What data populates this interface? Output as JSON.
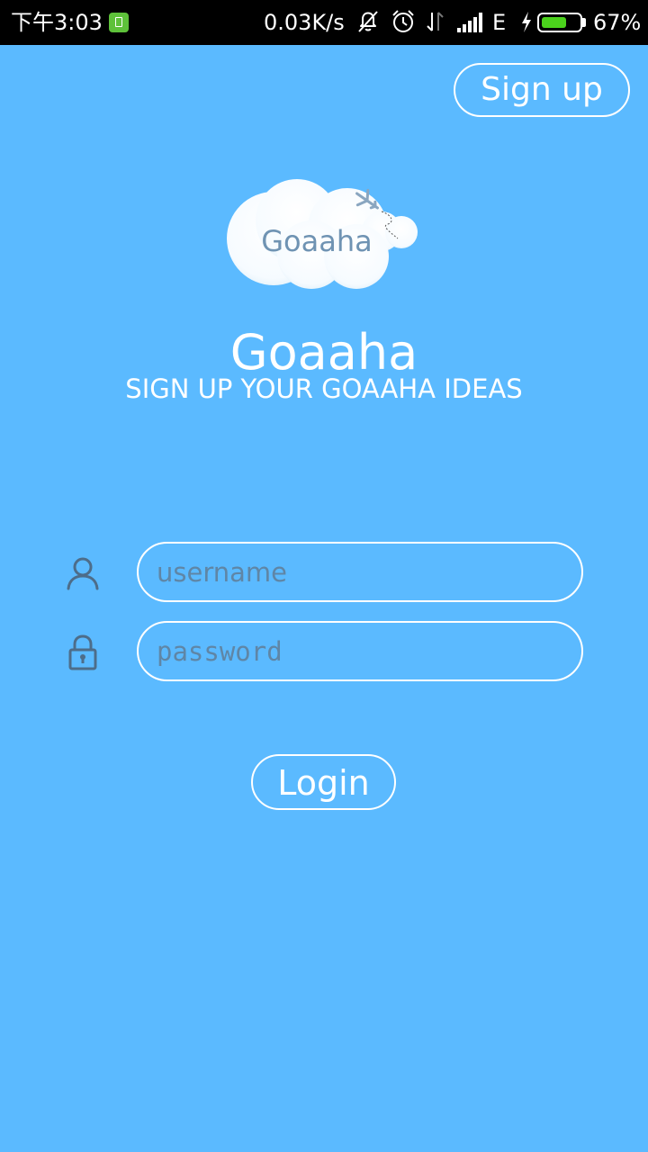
{
  "status_bar": {
    "time": "下午3:03",
    "net_speed": "0.03K/s",
    "network_type": "E",
    "battery_percent": "67%",
    "battery_level": 0.67,
    "icons": [
      "sim-icon",
      "mute-icon",
      "alarm-icon",
      "data-arrows-icon",
      "signal-icon",
      "charging-icon",
      "battery-icon"
    ]
  },
  "header": {
    "signup_label": "Sign up"
  },
  "logo": {
    "text": "Goaaha"
  },
  "app": {
    "title": "Goaaha",
    "tagline": "SIGN UP YOUR GOAAHA IDEAS"
  },
  "form": {
    "username_placeholder": "username",
    "username_value": "",
    "password_placeholder": "password",
    "password_value": "",
    "login_label": "Login"
  },
  "colors": {
    "background": "#5bbaff",
    "foreground": "#ffffff",
    "placeholder": "#5f86a6",
    "icon": "#4d6d8a",
    "battery": "#4bd21c"
  }
}
